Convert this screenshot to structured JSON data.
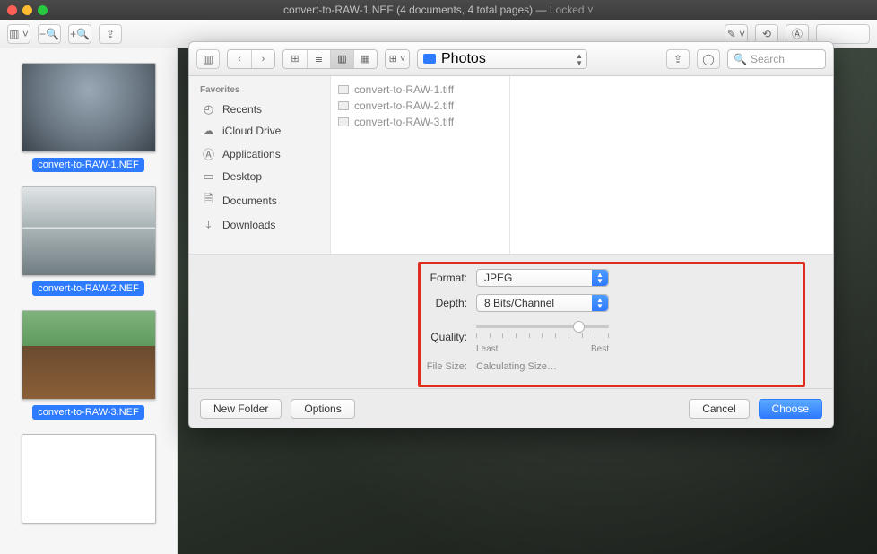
{
  "title": {
    "doc_icon": "page-icon",
    "filename": "convert-to-RAW-1.NEF",
    "docinfo": "(4 documents, 4 total pages)",
    "dash": "—",
    "locked": "Locked",
    "chev": "˅"
  },
  "thumbs": [
    {
      "label": "convert-to-RAW-1.NEF",
      "cls": "tree"
    },
    {
      "label": "convert-to-RAW-2.NEF",
      "cls": "lake"
    },
    {
      "label": "convert-to-RAW-3.NEF",
      "cls": "rooster"
    },
    {
      "label": "",
      "cls": "blank"
    }
  ],
  "sheet": {
    "folder": "Photos",
    "search_placeholder": "Search",
    "fav_header": "Favorites",
    "favs": [
      {
        "icon": "⌚",
        "label": "Recents"
      },
      {
        "icon": "☁",
        "label": "iCloud Drive"
      },
      {
        "icon": "A",
        "label": "Applications"
      },
      {
        "icon": "▭",
        "label": "Desktop"
      },
      {
        "icon": "🗎",
        "label": "Documents"
      },
      {
        "icon": "⬇",
        "label": "Downloads"
      }
    ],
    "files": [
      "convert-to-RAW-1.tiff",
      "convert-to-RAW-2.tiff",
      "convert-to-RAW-3.tiff"
    ],
    "format": {
      "format_label": "Format:",
      "format_value": "JPEG",
      "depth_label": "Depth:",
      "depth_value": "8 Bits/Channel",
      "quality_label": "Quality:",
      "least": "Least",
      "best": "Best",
      "filesize_label": "File Size:",
      "filesize_value": "Calculating Size…"
    },
    "buttons": {
      "newfolder": "New Folder",
      "options": "Options",
      "cancel": "Cancel",
      "choose": "Choose"
    }
  }
}
